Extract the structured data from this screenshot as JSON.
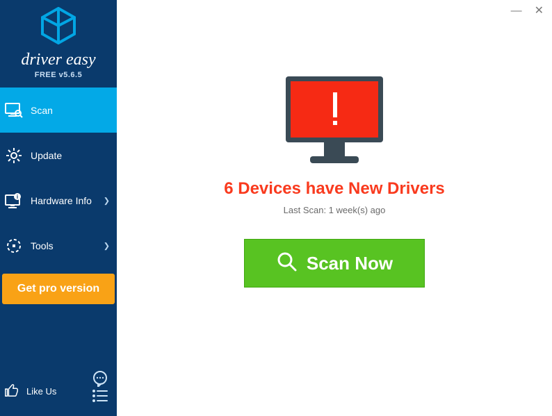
{
  "brand": {
    "name": "driver easy",
    "version_line": "FREE v5.6.5"
  },
  "sidebar": {
    "items": [
      {
        "label": "Scan",
        "icon": "monitor-scan-icon",
        "active": true,
        "expandable": false
      },
      {
        "label": "Update",
        "icon": "gear-icon",
        "active": false,
        "expandable": false
      },
      {
        "label": "Hardware Info",
        "icon": "hw-info-icon",
        "active": false,
        "expandable": true
      },
      {
        "label": "Tools",
        "icon": "tools-icon",
        "active": false,
        "expandable": true
      }
    ],
    "pro_button": "Get pro version",
    "like_us": "Like Us"
  },
  "window_controls": {
    "minimize": "—",
    "close": "✕"
  },
  "main": {
    "devices_count": 6,
    "headline_template": "Devices have New Drivers",
    "headline": "6 Devices have New Drivers",
    "last_scan": "Last Scan: 1 week(s) ago",
    "scan_button": "Scan Now"
  },
  "colors": {
    "sidebar_bg": "#0a3a6c",
    "sidebar_active": "#03a9e7",
    "pro_button": "#f9a216",
    "scan_button": "#58c322",
    "alert_red": "#f93a1e",
    "monitor_screen": "#f62a14"
  }
}
